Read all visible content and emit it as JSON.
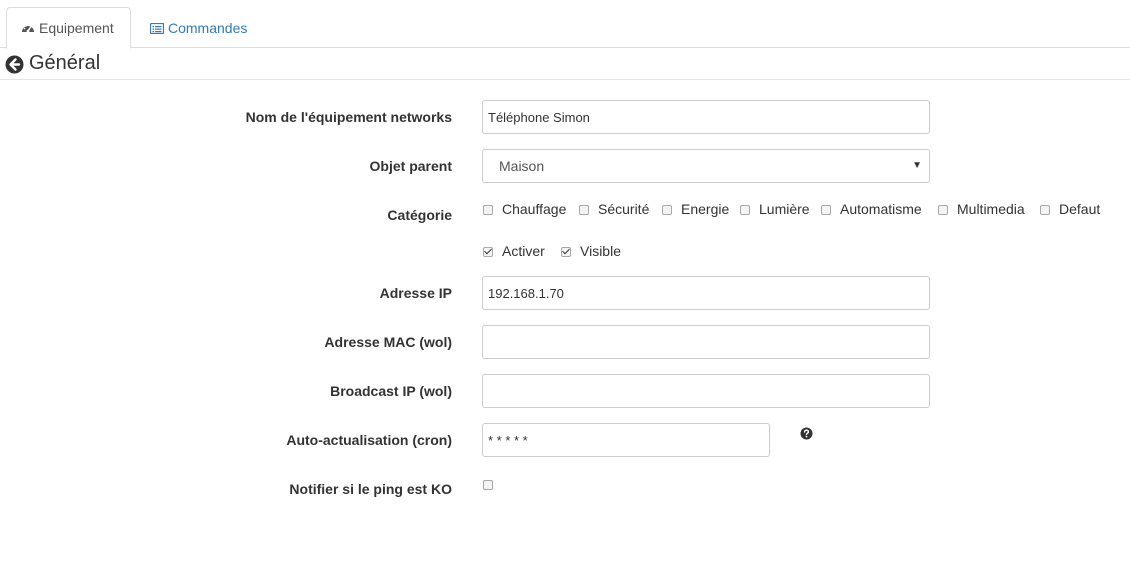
{
  "tabs": {
    "equipement": {
      "label": "Equipement",
      "icon": "tachometer-icon"
    },
    "commandes": {
      "label": "Commandes",
      "icon": "list-alt-icon"
    }
  },
  "section": {
    "title": "Général",
    "back_icon": "arrow-circle-left-icon"
  },
  "form": {
    "name": {
      "label": "Nom de l'équipement networks",
      "value": "Téléphone Simon"
    },
    "parent": {
      "label": "Objet parent",
      "value": "Maison"
    },
    "category": {
      "label": "Catégorie",
      "options": [
        "Chauffage",
        "Sécurité",
        "Energie",
        "Lumière",
        "Automatisme",
        "Multimedia",
        "Defaut"
      ]
    },
    "activer": {
      "label": "Activer",
      "checked": true
    },
    "visible": {
      "label": "Visible",
      "checked": true
    },
    "ip": {
      "label": "Adresse IP",
      "value": "192.168.1.70"
    },
    "mac": {
      "label": "Adresse MAC (wol)",
      "value": ""
    },
    "broadcast": {
      "label": "Broadcast IP (wol)",
      "value": ""
    },
    "cron": {
      "label": "Auto-actualisation (cron)",
      "value": "* * * * *"
    },
    "notify": {
      "label": "Notifier si le ping est KO",
      "checked": false
    }
  },
  "colors": {
    "link": "#337ab7",
    "border": "#cccccc",
    "text": "#333333"
  }
}
